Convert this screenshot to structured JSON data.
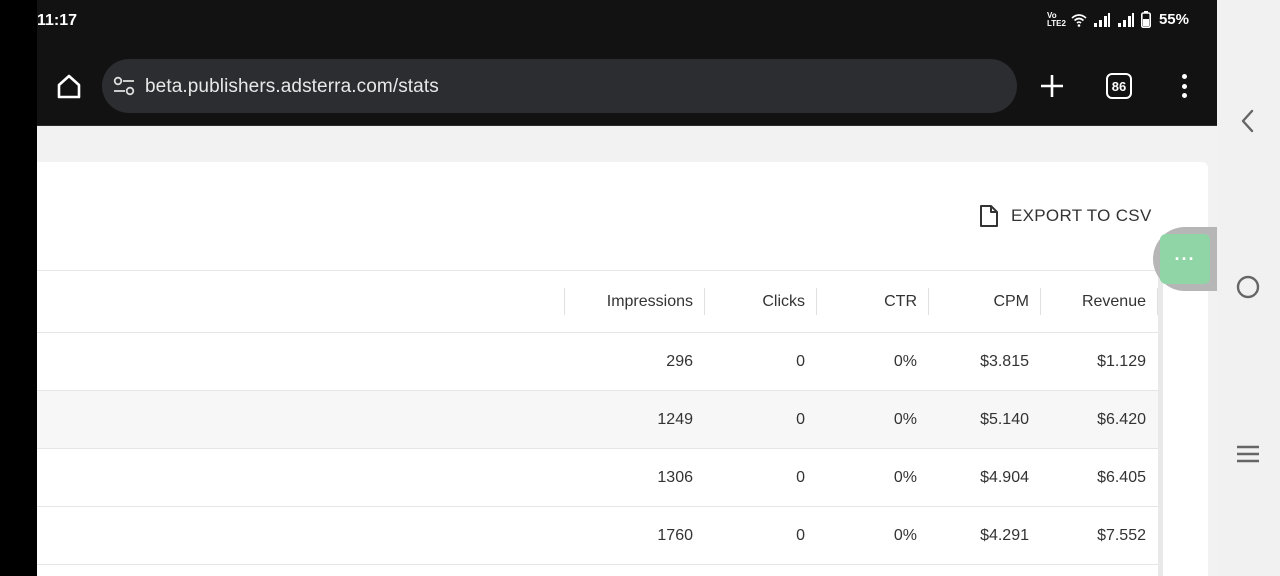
{
  "status_bar": {
    "time": "11:17",
    "network_label": "VoLTE2",
    "battery_percent": "55%"
  },
  "browser": {
    "url": "beta.publishers.adsterra.com/stats",
    "tab_count": "86"
  },
  "toolbar": {
    "export_label": "EXPORT TO CSV"
  },
  "table": {
    "columns": [
      "Impressions",
      "Clicks",
      "CTR",
      "CPM",
      "Revenue"
    ],
    "rows": [
      [
        "296",
        "0",
        "0%",
        "$3.815",
        "$1.129"
      ],
      [
        "1249",
        "0",
        "0%",
        "$5.140",
        "$6.420"
      ],
      [
        "1306",
        "0",
        "0%",
        "$4.904",
        "$6.405"
      ],
      [
        "1760",
        "0",
        "0%",
        "$4.291",
        "$7.552"
      ]
    ]
  },
  "floating_button": {
    "label": "···",
    "color": "#8fd5a6"
  },
  "icons": {
    "home": "home-icon",
    "site_info": "tune-icon",
    "new_tab": "plus-icon",
    "menu": "more-vert-icon",
    "export": "document-icon",
    "nav_back": "chevron-left-icon",
    "nav_home": "circle-icon",
    "nav_recents": "menu-lines-icon"
  }
}
